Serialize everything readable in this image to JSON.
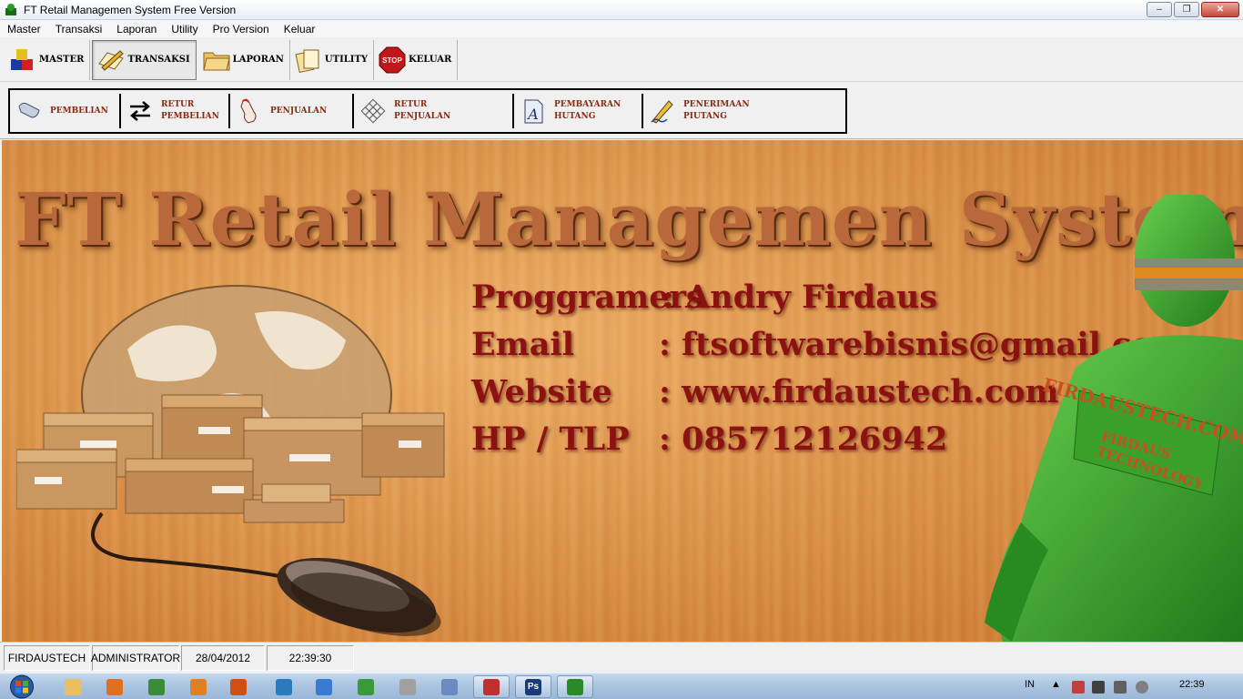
{
  "window": {
    "title": "FT Retail Managemen System Free Version",
    "controls": {
      "minimize": "‒",
      "maximize": "❐",
      "close": "✕"
    }
  },
  "menu": [
    "Master",
    "Transaksi",
    "Laporan",
    "Utility",
    "Pro Version",
    "Keluar"
  ],
  "toolbar": [
    {
      "label": "MASTER",
      "icon": "cubes-icon",
      "active": false
    },
    {
      "label": "TRANSAKSI",
      "icon": "pencil-paper-icon",
      "active": true
    },
    {
      "label": "LAPORAN",
      "icon": "folder-icon",
      "active": false
    },
    {
      "label": "UTILITY",
      "icon": "documents-icon",
      "active": false
    },
    {
      "label": "KELUAR",
      "icon": "stop-sign-icon",
      "active": false,
      "icon_text": "STOP"
    }
  ],
  "subtoolbar": [
    {
      "label": "PEMBELIAN",
      "icon": "scroll-icon"
    },
    {
      "label": "RETUR\nPEMBELIAN",
      "icon": "swap-arrows-icon"
    },
    {
      "label": "PENJUALAN",
      "icon": "hand-cursor-icon"
    },
    {
      "label": "RETUR\nPENJUALAN",
      "icon": "grid-icon"
    },
    {
      "label": "PEMBAYARAN\nHUTANG",
      "icon": "document-a-icon"
    },
    {
      "label": "PENERIMAAN\nPIUTANG",
      "icon": "pen-signature-icon"
    }
  ],
  "banner": {
    "title": "FT Retail Managemen System",
    "info": [
      {
        "label": "Proggramers",
        "value": ": Andry Firdaus"
      },
      {
        "label": "Email",
        "value": ": ftsoftwarebisnis@gmail.com"
      },
      {
        "label": "Website",
        "value": ": www.firdaustech.com"
      },
      {
        "label": "HP / TLP",
        "value": ": 085712126942"
      }
    ],
    "mascot_text": [
      "FIRDAUSTECH.COM",
      "FIRDAUS",
      "TECHNOLOGY"
    ]
  },
  "status": {
    "company": "FIRDAUSTECH",
    "user": "ADMINISTRATOR",
    "date": "28/04/2012",
    "time": "22:39:30"
  },
  "taskbar": {
    "items": [
      {
        "name": "explorer",
        "color": "#e8c060",
        "open": false
      },
      {
        "name": "media-player",
        "color": "#e07020",
        "open": false
      },
      {
        "name": "chrome",
        "color": "#3a8a3a",
        "open": false
      },
      {
        "name": "app-orange",
        "color": "#e08020",
        "open": false
      },
      {
        "name": "firefox",
        "color": "#d05010",
        "open": false
      },
      {
        "name": "maxthon",
        "color": "#2a7ac0",
        "open": false
      },
      {
        "name": "ie",
        "color": "#3a7ad0",
        "open": false
      },
      {
        "name": "green-app",
        "color": "#3a9a3a",
        "open": false
      },
      {
        "name": "cat-app",
        "color": "#a0a0a0",
        "open": false
      },
      {
        "name": "cat-app-2",
        "color": "#6a8ac0",
        "open": false
      },
      {
        "name": "mail-app",
        "color": "#c03030",
        "open": true
      },
      {
        "name": "photoshop",
        "color": "#1a3a7a",
        "open": true,
        "text": "Ps"
      },
      {
        "name": "ft-retail",
        "color": "#2a8a2a",
        "open": true
      }
    ],
    "language": "IN",
    "clock": "22:39"
  },
  "colors": {
    "banner_text": "#8c1111",
    "sub_label": "#8b2a10",
    "mascot": "#3aa02a"
  }
}
